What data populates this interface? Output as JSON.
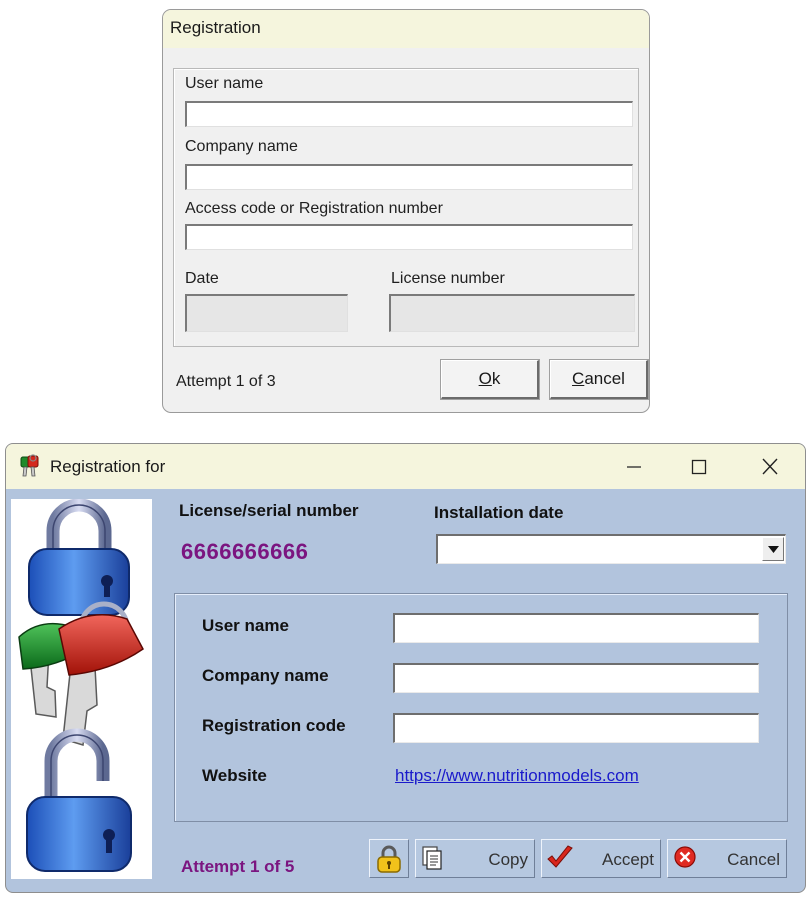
{
  "dialog1": {
    "title": "Registration",
    "user_name_label": "User name",
    "company_name_label": "Company name",
    "access_code_label": "Access code or Registration number",
    "date_label": "Date",
    "license_number_label": "License number",
    "attempt": "Attempt 1 of 3",
    "ok_button": "Ok",
    "ok_mnemonic": "O",
    "ok_rest": "k",
    "cancel_button": "Cancel",
    "cancel_mnemonic": "C",
    "cancel_rest": "ancel"
  },
  "window2": {
    "title": "Registration for",
    "license_serial_label": "License/serial number",
    "serial_value": "6666666666",
    "installation_date_label": "Installation date",
    "installation_date_value": "",
    "user_name_label": "User name",
    "company_name_label": "Company name",
    "registration_code_label": "Registration code",
    "website_label": "Website",
    "website_url": "https://www.nutritionmodels.com",
    "attempt": "Attempt 1 of 5",
    "copy_button": "Copy",
    "accept_button": "Accept",
    "cancel_button": "Cancel",
    "colors": {
      "title_bar": "#f5f5dd",
      "body": "#b2c4dd",
      "accent_text": "#7b1580",
      "link": "#1a1acb"
    }
  }
}
